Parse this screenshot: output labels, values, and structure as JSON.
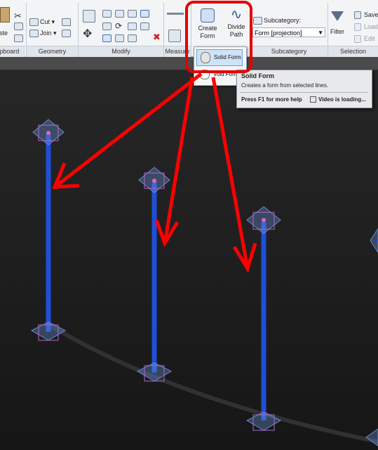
{
  "ribbon": {
    "clipboard": {
      "panel_label": "Clipboard",
      "paste_label": "Paste"
    },
    "geometry": {
      "panel_label": "Geometry",
      "cut_label": "Cut",
      "join_label": "Join"
    },
    "modify": {
      "panel_label": "Modify"
    },
    "measure": {
      "panel_label": "Measure"
    },
    "form": {
      "create_form_label": "Create Form",
      "divide_path_label": "Divide Path",
      "dropdown": {
        "solid_form_label": "Solid Form",
        "void_form_label": "Void Form"
      }
    },
    "subcategory": {
      "panel_label": "Subcategory",
      "field_label": "Subcategory:",
      "selected_value": "Form [projection]"
    },
    "selection": {
      "panel_label": "Selection",
      "filter_label": "Filter",
      "save_label": "Save",
      "load_label": "Load",
      "edit_label": "Edit"
    }
  },
  "tooltip": {
    "title": "Solid Form",
    "description": "Creates a form from selected lines.",
    "help_text": "Press F1 for more help",
    "video_text": "Video is loading..."
  },
  "colors": {
    "annotation_red": "#ff0000",
    "column_blue": "#1f4fd8",
    "ribbon_bg": "#f3f4f6"
  }
}
